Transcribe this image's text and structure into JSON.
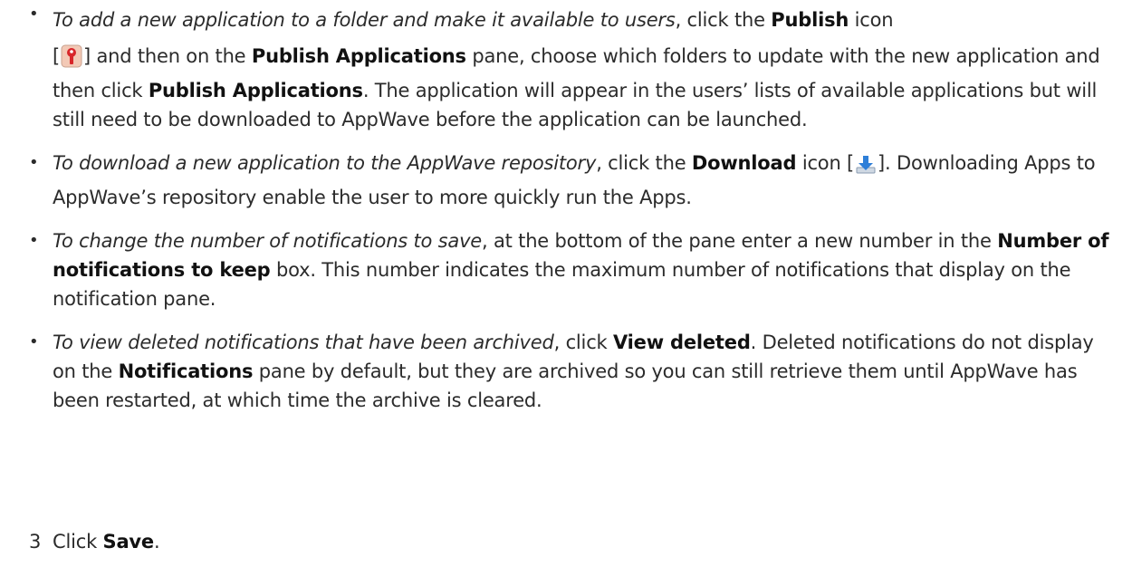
{
  "bullets": [
    {
      "lead": "To add a new application to a folder and make it available to users",
      "t1": ", click the ",
      "b1": "Publish",
      "t2": " icon",
      "t3": "[",
      "t4": "] and then on the ",
      "b2": "Publish Applications",
      "t5": " pane, choose which folders to update with the new application and then click ",
      "b3": "Publish Applications",
      "t6": ". The application will appear in the users’ lists of available applications but will still need to be downloaded to AppWave before the application can be launched.",
      "icon": "publish-icon"
    },
    {
      "lead": "To download a new application to the AppWave repository",
      "t1": ", click the ",
      "b1": "Download",
      "t2": " icon [",
      "t3": "]. Downloading Apps to AppWave’s repository enable the user to more quickly run the Apps.",
      "icon": "download-icon"
    },
    {
      "lead": "To change the number of notifications to save",
      "t1": ", at the bottom of the pane enter a new number in the ",
      "b1": "Number of notifications to keep",
      "t2": " box. This number indicates the maximum number of notifications that display on the notification pane."
    },
    {
      "lead": "To view deleted notifications that have been archived",
      "t1": ", click ",
      "b1": "View deleted",
      "t2": ". Deleted notifications do not display on the ",
      "b2": "Notifications",
      "t3": " pane by default, but they are archived so you can still retrieve them until AppWave has been restarted, at which time the archive is cleared."
    }
  ],
  "bullet_symbol": "•",
  "step": {
    "number": "3",
    "t1": "Click ",
    "b1": "Save",
    "t2": "."
  },
  "colors": {
    "text": "#2b2b2b",
    "publish_icon_red": "#d8262a",
    "download_icon_blue": "#2f7fd8"
  }
}
